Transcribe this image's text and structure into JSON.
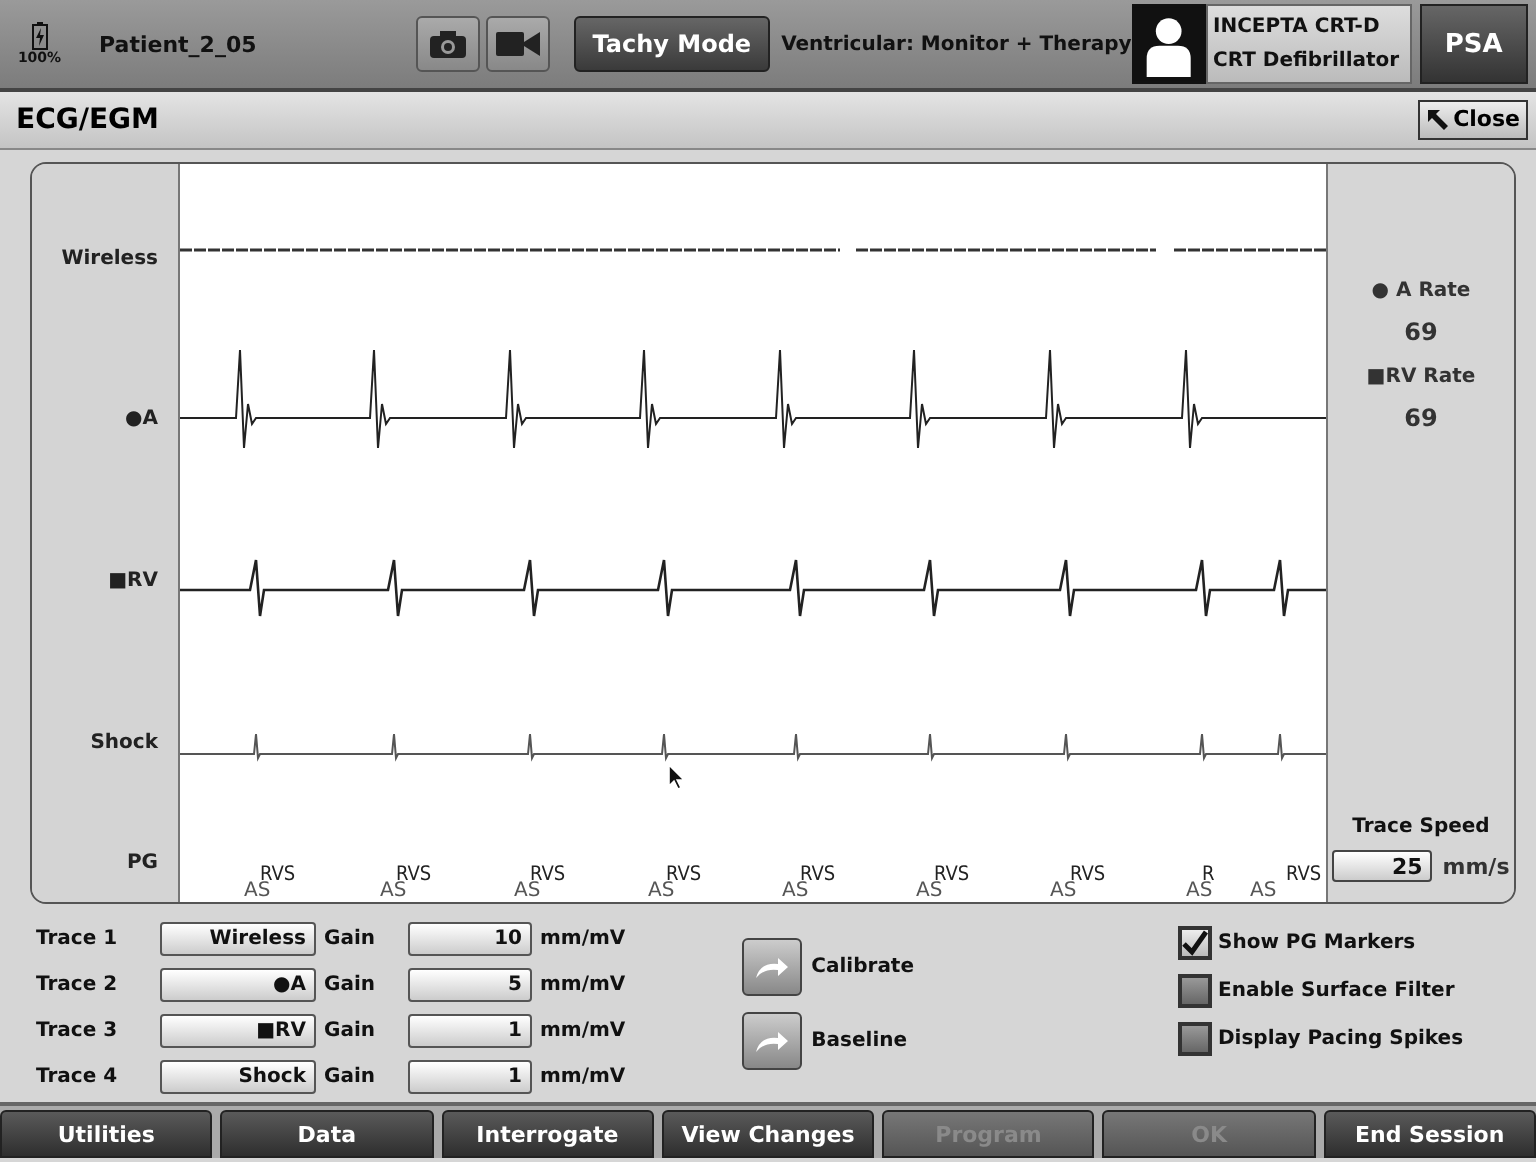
{
  "status_bar": {
    "battery": "100%",
    "patient": "Patient_2_05",
    "mode_button": "Tachy Mode",
    "mode_status": "Ventricular: Monitor + Therapy",
    "device_model": "INCEPTA CRT-D",
    "device_type": "CRT Defibrillator",
    "psa_button": "PSA"
  },
  "panel": {
    "title": "ECG/EGM",
    "close_button": "Close"
  },
  "traces": [
    {
      "label": "Wireless",
      "kind": "surface"
    },
    {
      "label": "●A",
      "kind": "atrial"
    },
    {
      "label": "■RV",
      "kind": "ventricular"
    },
    {
      "label": "Shock",
      "kind": "shock"
    },
    {
      "label": "PG",
      "kind": "markers"
    }
  ],
  "pg_markers": [
    {
      "upper": "RVS",
      "lower": "AS"
    },
    {
      "upper": "RVS",
      "lower": "AS"
    },
    {
      "upper": "RVS",
      "lower": "AS"
    },
    {
      "upper": "RVS",
      "lower": "AS"
    },
    {
      "upper": "RVS",
      "lower": "AS"
    },
    {
      "upper": "RVS",
      "lower": "AS"
    },
    {
      "upper": "RVS",
      "lower": "AS"
    },
    {
      "upper": "R",
      "lower": "AS"
    },
    {
      "upper": "RVS",
      "lower": "AS"
    }
  ],
  "rates": [
    {
      "label": "● A Rate",
      "value": "69"
    },
    {
      "label": "■RV Rate",
      "value": "69"
    }
  ],
  "trace_speed": {
    "label": "Trace Speed",
    "value": "25",
    "unit": "mm/s"
  },
  "trace_settings": [
    {
      "label": "Trace 1",
      "source": "Wireless",
      "gain_label": "Gain",
      "gain": "10",
      "unit": "mm/mV"
    },
    {
      "label": "Trace 2",
      "source": "●A",
      "gain_label": "Gain",
      "gain": "5",
      "unit": "mm/mV"
    },
    {
      "label": "Trace 3",
      "source": "■RV",
      "gain_label": "Gain",
      "gain": "1",
      "unit": "mm/mV"
    },
    {
      "label": "Trace 4",
      "source": "Shock",
      "gain_label": "Gain",
      "gain": "1",
      "unit": "mm/mV"
    }
  ],
  "actions": [
    {
      "label": "Calibrate"
    },
    {
      "label": "Baseline"
    }
  ],
  "options": [
    {
      "label": "Show PG Markers",
      "checked": true
    },
    {
      "label": "Enable Surface Filter",
      "checked": false
    },
    {
      "label": "Display Pacing Spikes",
      "checked": false
    }
  ],
  "nav_buttons": [
    {
      "label": "Utilities",
      "disabled": false
    },
    {
      "label": "Data",
      "disabled": false
    },
    {
      "label": "Interrogate",
      "disabled": false
    },
    {
      "label": "View Changes",
      "disabled": false
    },
    {
      "label": "Program",
      "disabled": true
    },
    {
      "label": "OK",
      "disabled": true
    },
    {
      "label": "End Session",
      "disabled": false
    }
  ]
}
